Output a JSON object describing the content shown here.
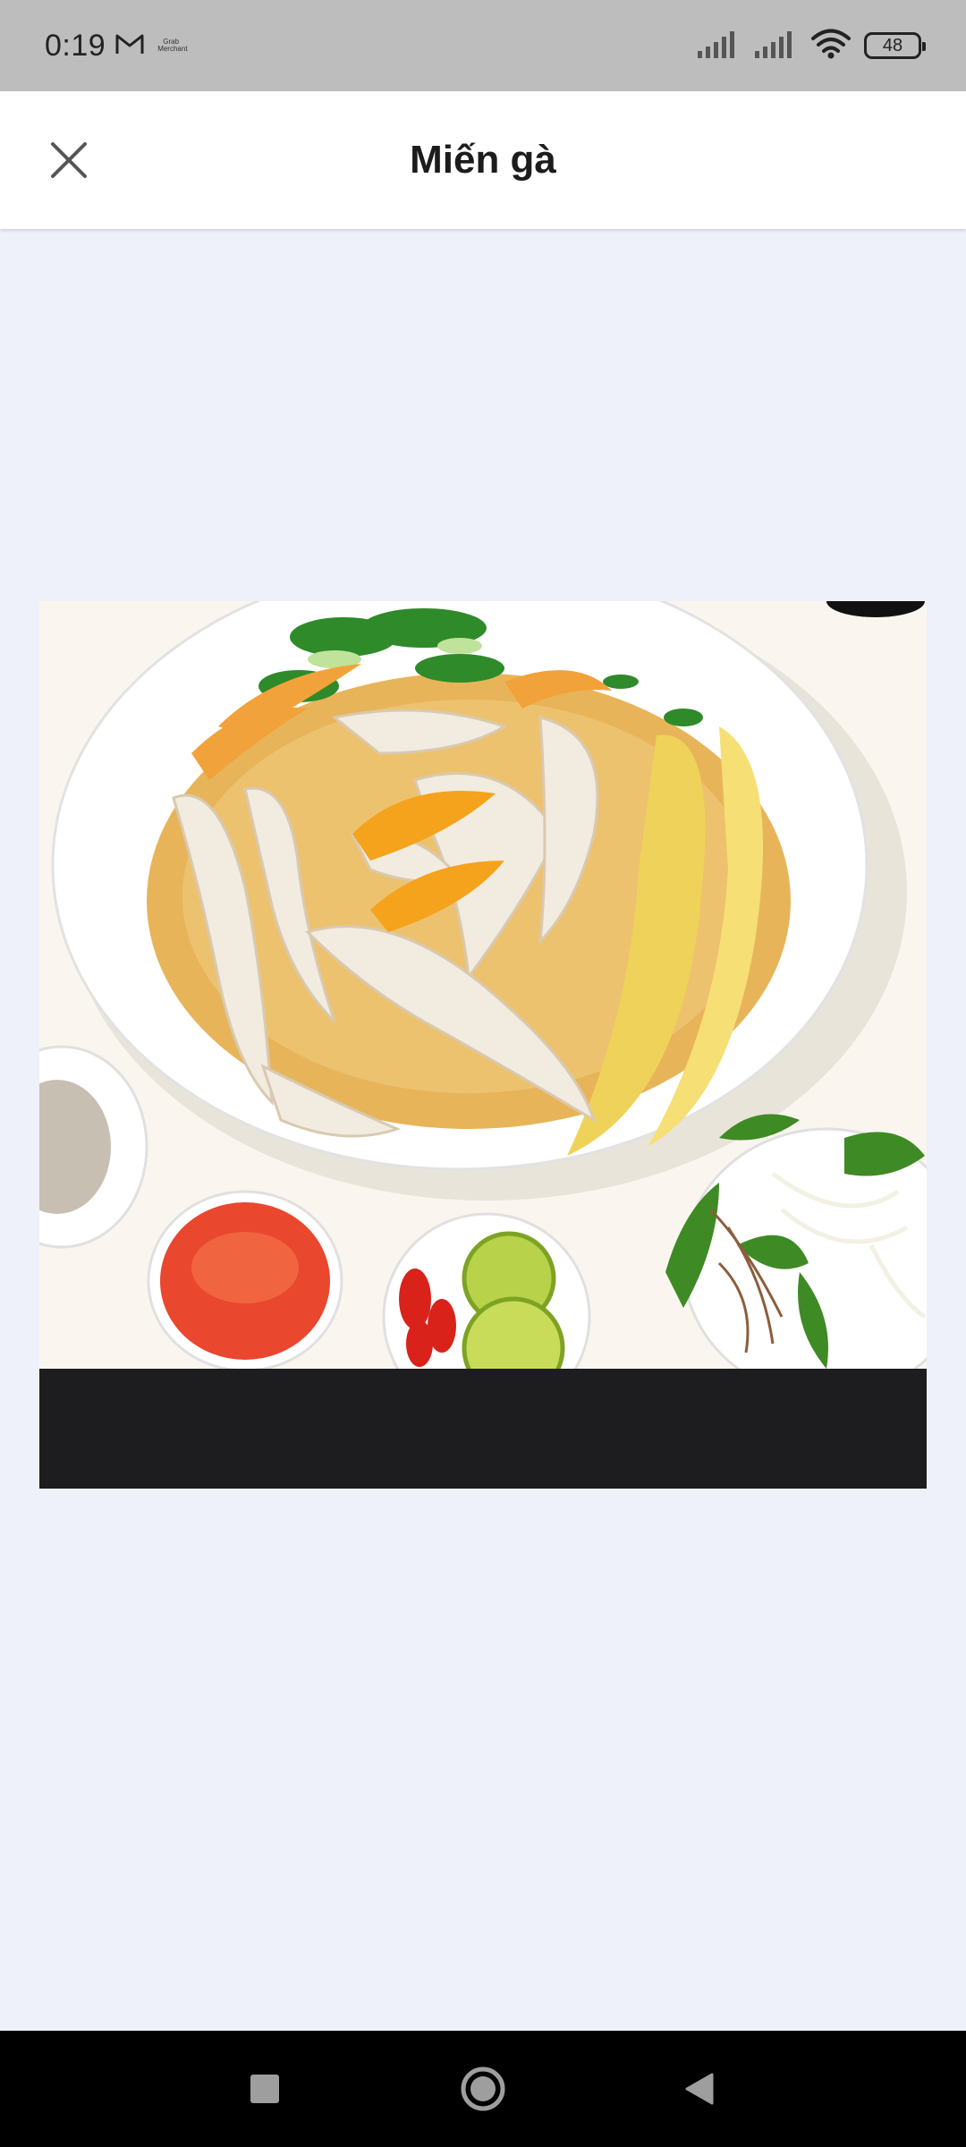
{
  "status_bar": {
    "time": "0:19",
    "mini_label_line1": "Grab",
    "mini_label_line2": "Merchant",
    "battery": "48"
  },
  "header": {
    "title": "Miến gà",
    "close_icon": "close-icon"
  },
  "image": {
    "subject": "chicken-glass-noodle-soup",
    "background_color": "#faf6ef",
    "caption_strip_color": "#1d1d1f"
  },
  "nav_bar": {
    "recents_icon": "square-icon",
    "home_icon": "circle-icon",
    "back_icon": "back-triangle-icon"
  },
  "colors": {
    "page_background": "#eef0fa",
    "status_bar": "#bdbdbd",
    "header_background": "#ffffff",
    "nav_bar": "#000000"
  }
}
